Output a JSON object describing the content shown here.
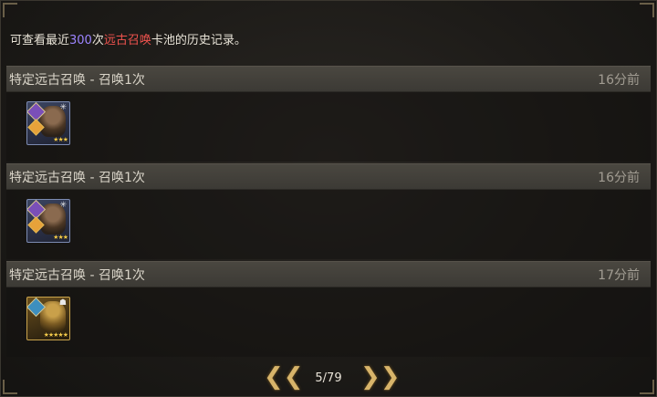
{
  "intro": {
    "prefix": "可查看最近",
    "count": "300",
    "mid": "次",
    "pool_name": "远古召唤",
    "suffix": "卡池的历史记录。"
  },
  "records": [
    {
      "title": "特定远古召唤 - 召唤1次",
      "time": "16分前",
      "hero": {
        "frame": "blue",
        "class_icon": "purple-diamond-icon",
        "faction_icon": "orange-diamond-icon",
        "corner_glyph": "✳",
        "stars": "★★★"
      }
    },
    {
      "title": "特定远古召唤 - 召唤1次",
      "time": "16分前",
      "hero": {
        "frame": "blue",
        "class_icon": "purple-diamond-icon",
        "faction_icon": "orange-diamond-icon",
        "corner_glyph": "✳",
        "stars": "★★★"
      }
    },
    {
      "title": "特定远古召唤 - 召唤1次",
      "time": "17分前",
      "hero": {
        "frame": "gold",
        "class_icon": "blue-diamond-icon",
        "corner_glyph": "☗",
        "stars": "★★★★★"
      }
    }
  ],
  "pager": {
    "prev_icon": "double-chevron-left-icon",
    "next_icon": "double-chevron-right-icon",
    "prev_glyph": "❮❮",
    "next_glyph": "❯❯",
    "page": "5/79"
  },
  "colors": {
    "count_accent": "#9c84ff",
    "pool_accent": "#f0534e",
    "pager_gold": "#d7b46a"
  }
}
